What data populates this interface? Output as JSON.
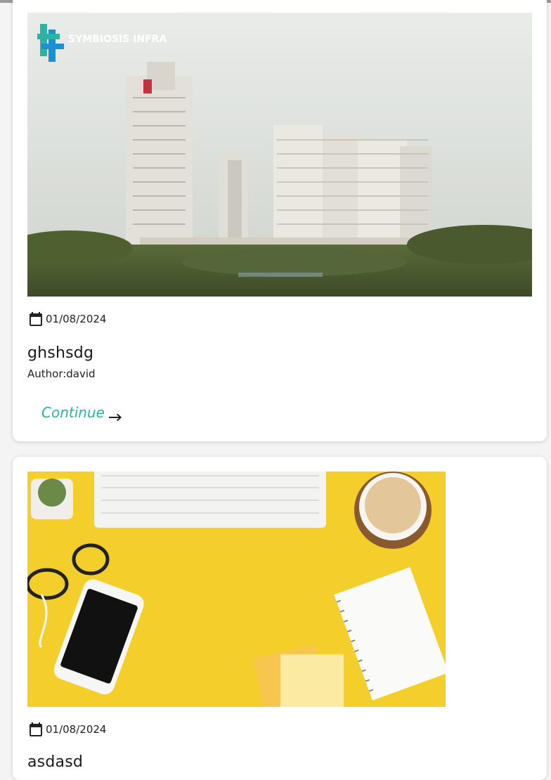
{
  "posts": [
    {
      "image_alt": "Building towers render",
      "logo_text": "SYMBIOSIS INFRA",
      "date": "01/08/2024",
      "title": "ghshsdg",
      "author": "Author:david",
      "continue_label": "Continue"
    },
    {
      "image_alt": "Desk flatlay",
      "date": "01/08/2024",
      "title": "asdasd"
    }
  ],
  "colors": {
    "accent": "#2bb3a3",
    "card_bg": "#ffffff",
    "page_bg": "#f4f4f4"
  },
  "icons": [
    "calendar-icon",
    "arrow-right-icon"
  ]
}
